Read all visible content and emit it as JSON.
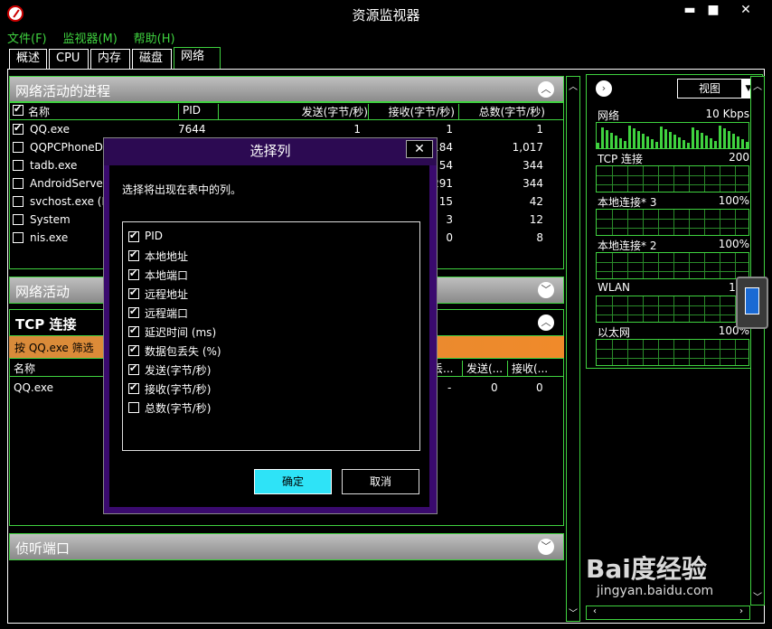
{
  "window": {
    "title": "资源监视器",
    "minimize": "▬",
    "maximize": "■",
    "close": "✕"
  },
  "menu": [
    "文件(F)",
    "监视器(M)",
    "帮助(H)"
  ],
  "tabs": [
    "概述",
    "CPU",
    "内存",
    "磁盘",
    "网络"
  ],
  "active_tab": "网络",
  "processes": {
    "title": "网络活动的进程",
    "headers": {
      "name": "名称",
      "pid": "PID",
      "send": "发送(字节/秒)",
      "recv": "接收(字节/秒)",
      "total": "总数(字节/秒)"
    },
    "rows": [
      {
        "checked": true,
        "name": "QQ.exe",
        "pid": "7644",
        "send": "1",
        "recv": "1",
        "total": "1"
      },
      {
        "checked": false,
        "name": "QQPCPhoneDo",
        "pid": "",
        "send": "",
        "recv": "184",
        "total": "1,017"
      },
      {
        "checked": false,
        "name": "tadb.exe",
        "pid": "",
        "send": "",
        "recv": "54",
        "total": "344"
      },
      {
        "checked": false,
        "name": "AndroidServer.e",
        "pid": "",
        "send": "",
        "recv": "291",
        "total": "344"
      },
      {
        "checked": false,
        "name": "svchost.exe (Ne",
        "pid": "",
        "send": "",
        "recv": "15",
        "total": "42"
      },
      {
        "checked": false,
        "name": "System",
        "pid": "",
        "send": "",
        "recv": "3",
        "total": "12"
      },
      {
        "checked": false,
        "name": "nis.exe",
        "pid": "",
        "send": "",
        "recv": "0",
        "total": "8"
      }
    ]
  },
  "network_activity": {
    "title": "网络活动"
  },
  "tcp": {
    "title": "TCP 连接",
    "filter": "按 QQ.exe 筛选",
    "headers": {
      "name": "名称",
      "loss": "丢...",
      "send": "发送(...",
      "recv": "接收(..."
    },
    "row": {
      "name": "QQ.exe",
      "loss": "-",
      "send": "0",
      "recv": "0"
    }
  },
  "listening": {
    "title": "侦听端口"
  },
  "right": {
    "view": "视图",
    "graphs": [
      {
        "label": "网络",
        "value": "10 Kbps"
      },
      {
        "label": "TCP 连接",
        "value": "200"
      },
      {
        "label": "本地连接* 3",
        "value": "100%"
      },
      {
        "label": "本地连接* 2",
        "value": "100%"
      },
      {
        "label": "WLAN",
        "value": "100"
      },
      {
        "label": "以太网",
        "value": "100%"
      }
    ]
  },
  "dialog": {
    "title": "选择列",
    "close": "✕",
    "prompt": "选择将出现在表中的列。",
    "items": [
      {
        "label": "PID",
        "checked": true
      },
      {
        "label": "本地地址",
        "checked": true
      },
      {
        "label": "本地端口",
        "checked": true
      },
      {
        "label": "远程地址",
        "checked": true
      },
      {
        "label": "远程端口",
        "checked": true
      },
      {
        "label": "延迟时间 (ms)",
        "checked": true
      },
      {
        "label": "数据包丢失 (%)",
        "checked": true
      },
      {
        "label": "发送(字节/秒)",
        "checked": true
      },
      {
        "label": "接收(字节/秒)",
        "checked": true
      },
      {
        "label": "总数(字节/秒)",
        "checked": false
      }
    ],
    "ok": "确定",
    "cancel": "取消"
  },
  "watermark": {
    "brand": "Bai度经验",
    "url": "jingyan.baidu.com"
  },
  "colors": {
    "accent": "#3fd23f",
    "dialog_bg": "#3a0a6e",
    "ok_button": "#2ee3f7",
    "filter_bar": "#f08a2a"
  }
}
